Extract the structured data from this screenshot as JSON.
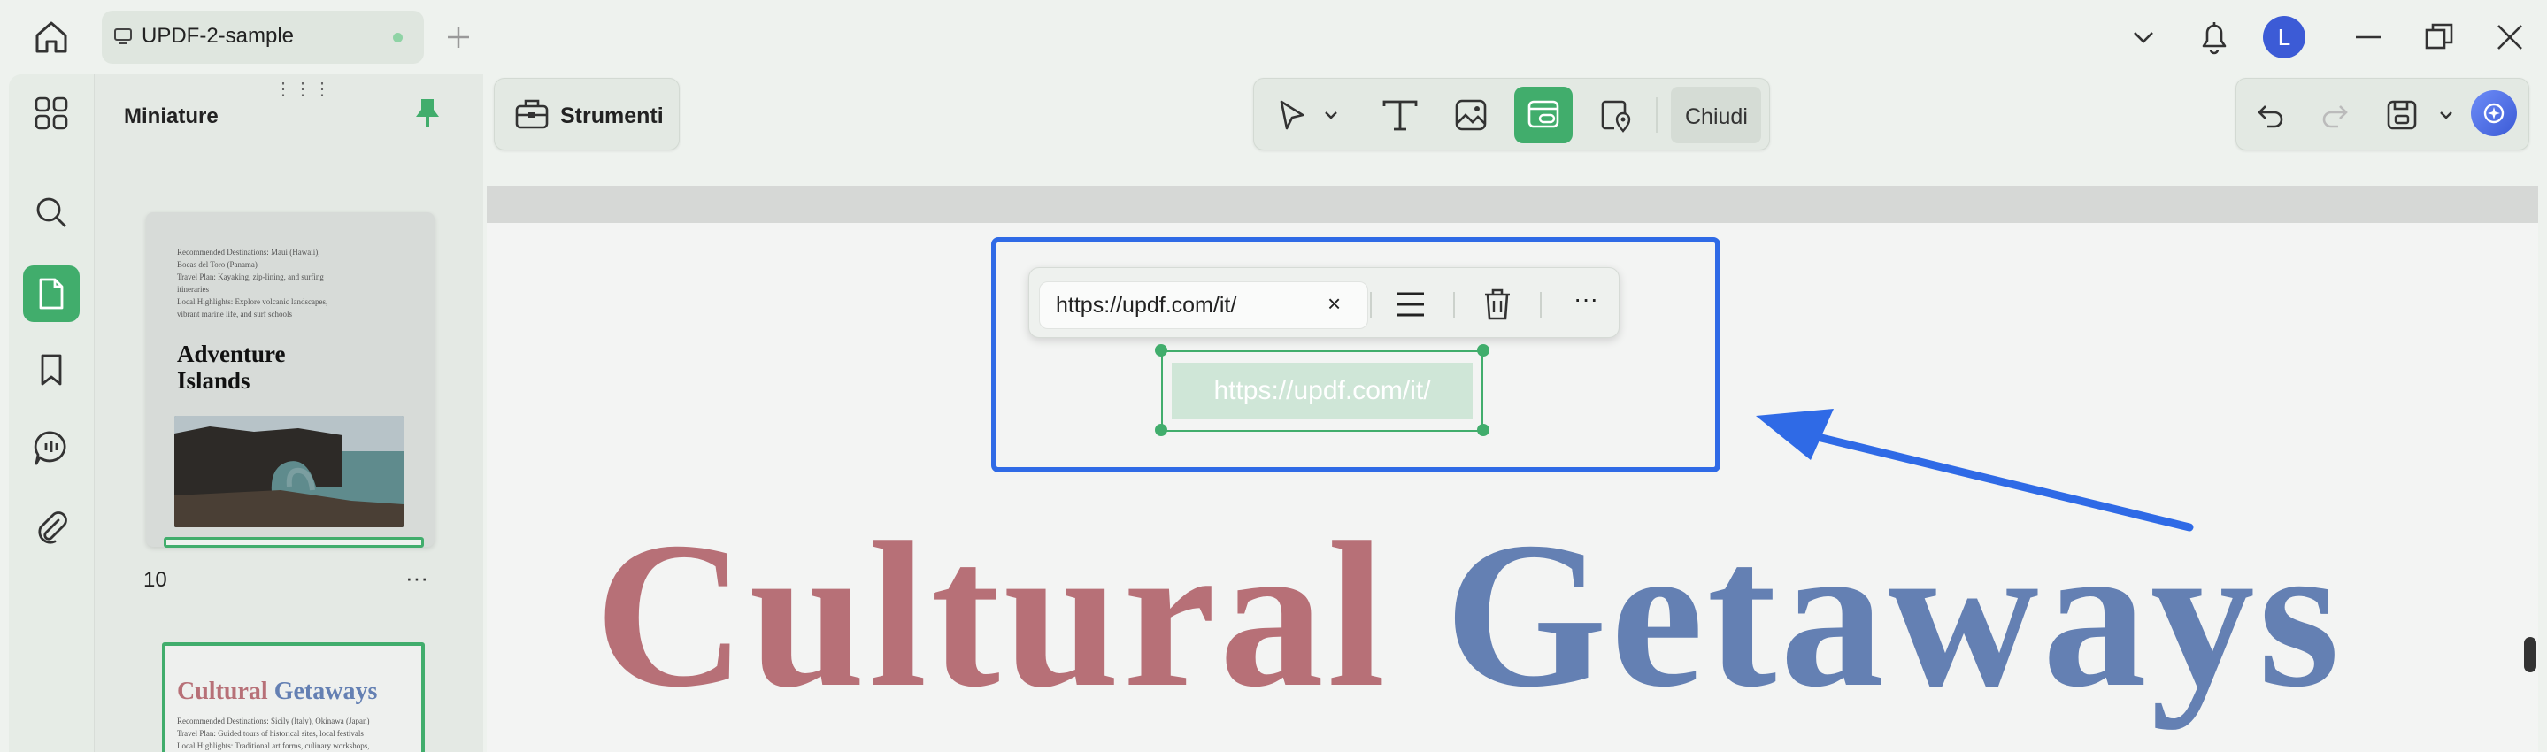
{
  "window": {
    "tab_title": "UPDF-2-sample",
    "avatar_letter": "L"
  },
  "thumbnails": {
    "title": "Miniature",
    "page1": {
      "text_lines": [
        "Recommended Destinations: Maui (Hawaii),",
        "Bocas del Toro (Panama)",
        "Travel Plan: Kayaking, zip-lining, and surfing",
        "itineraries",
        "Local Highlights: Explore volcanic landscapes,",
        "vibrant marine life, and surf schools"
      ],
      "title_line1": "Adventure",
      "title_line2": "Islands",
      "page_number": "10",
      "more": "···"
    },
    "page2": {
      "title_word1": "Cultural",
      "title_word2": "Getaways",
      "text_lines": [
        "Recommended Destinations: Sicily (Italy), Okinawa (Japan)",
        "Travel Plan: Guided tours of historical sites, local festivals",
        "Local Highlights: Traditional art forms, culinary workshops,"
      ]
    }
  },
  "toolbar": {
    "tools_label": "Strumenti",
    "close_label": "Chiudi"
  },
  "link_popup": {
    "url_value": "https://updf.com/it/",
    "clear": "×",
    "more": "···"
  },
  "document": {
    "link_text": "https://updf.com/it/",
    "headline_word1": "Cultural",
    "headline_word2": "Getaways"
  },
  "colors": {
    "accent_green": "#41ad6c",
    "highlight_blue": "#2f6ae6",
    "headline_red": "#b77077",
    "headline_blue": "#6480b3"
  }
}
